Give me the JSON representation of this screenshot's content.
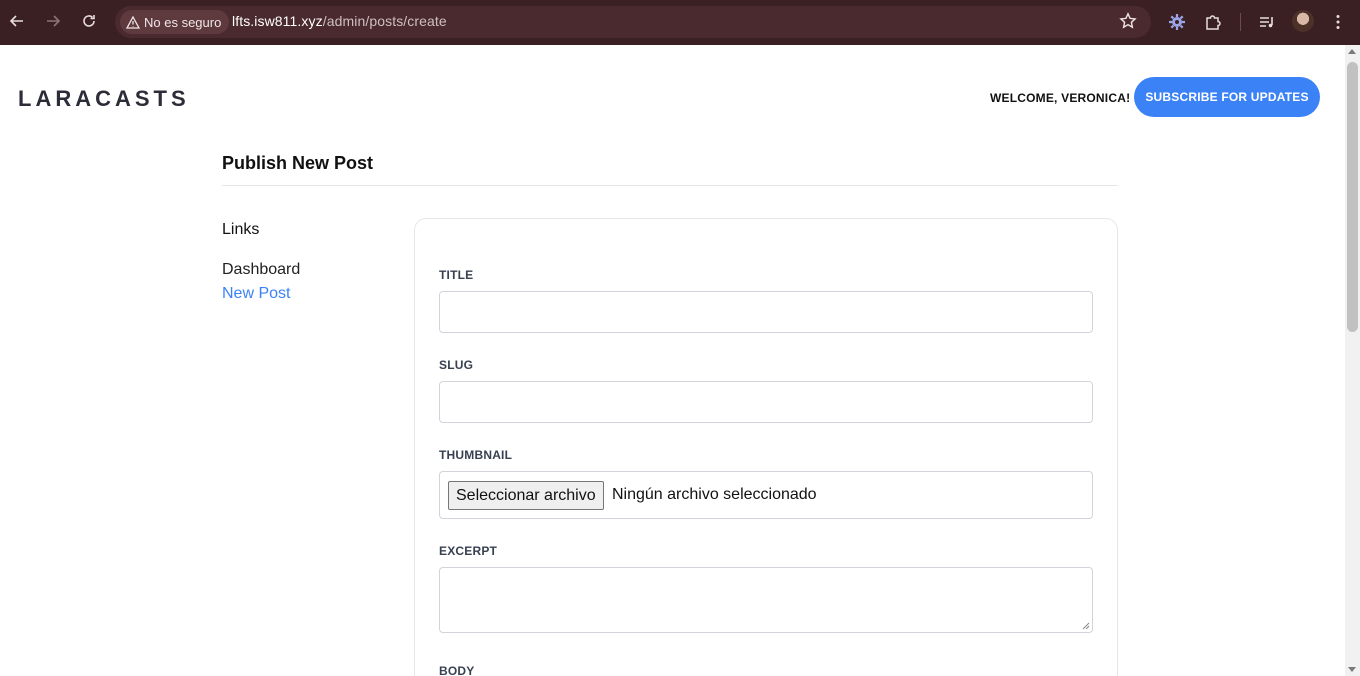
{
  "browser": {
    "security_label": "No es seguro",
    "url_host": "lfts.isw811.xyz",
    "url_path": "/admin/posts/create"
  },
  "header": {
    "logo_text": "LARACASTS",
    "welcome_text": "WELCOME, VERONICA!",
    "subscribe_label": "SUBSCRIBE FOR UPDATES"
  },
  "page": {
    "title": "Publish New Post"
  },
  "sidebar": {
    "heading": "Links",
    "items": [
      {
        "label": "Dashboard",
        "active": false
      },
      {
        "label": "New Post",
        "active": true
      }
    ]
  },
  "form": {
    "title_label": "TITLE",
    "title_value": "",
    "slug_label": "SLUG",
    "slug_value": "",
    "thumbnail_label": "THUMBNAIL",
    "thumbnail_button": "Seleccionar archivo",
    "thumbnail_status": "Ningún archivo seleccionado",
    "excerpt_label": "EXCERPT",
    "excerpt_value": "",
    "body_label": "BODY"
  },
  "colors": {
    "accent": "#3b82f6",
    "chrome_bg": "#3a2023"
  }
}
